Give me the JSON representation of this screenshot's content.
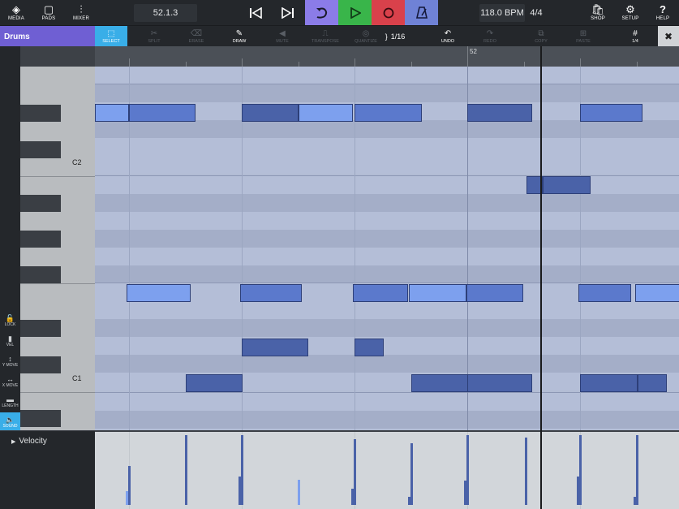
{
  "topbar": {
    "media": "MEDIA",
    "pads": "PADS",
    "mixer": "MIXER",
    "position": "52.1.3",
    "tempo": "118.0 BPM",
    "signature": "4/4",
    "shop": "SHOP",
    "setup": "SETUP",
    "help": "HELP",
    "colors": {
      "loop": "#8b7ce8",
      "play": "#39b54a",
      "record": "#d9414b",
      "metronome": "#6f82d6"
    }
  },
  "toolbar": {
    "track_name": "Drums",
    "select": "SELECT",
    "split": "SPLIT",
    "erase": "ERASE",
    "draw": "DRAW",
    "mute": "MUTE",
    "transpose": "TRANSPOSE",
    "quantize": "QUANTIZE",
    "quantize_value": "1/16",
    "undo": "UNDO",
    "redo": "REDO",
    "copy": "COPY",
    "paste": "PASTE",
    "grid_value": "1/4"
  },
  "sidebar": {
    "lock": "LOCK",
    "vel": "VEL",
    "ymove": "Y MOVE",
    "xmove": "X MOVE",
    "length": "LENGTH",
    "sound": "SOUND"
  },
  "keyboard": {
    "c2": "C2",
    "c1": "C1"
  },
  "ruler": {
    "bar_52": "52"
  },
  "velocity": {
    "label": "Velocity"
  }
}
